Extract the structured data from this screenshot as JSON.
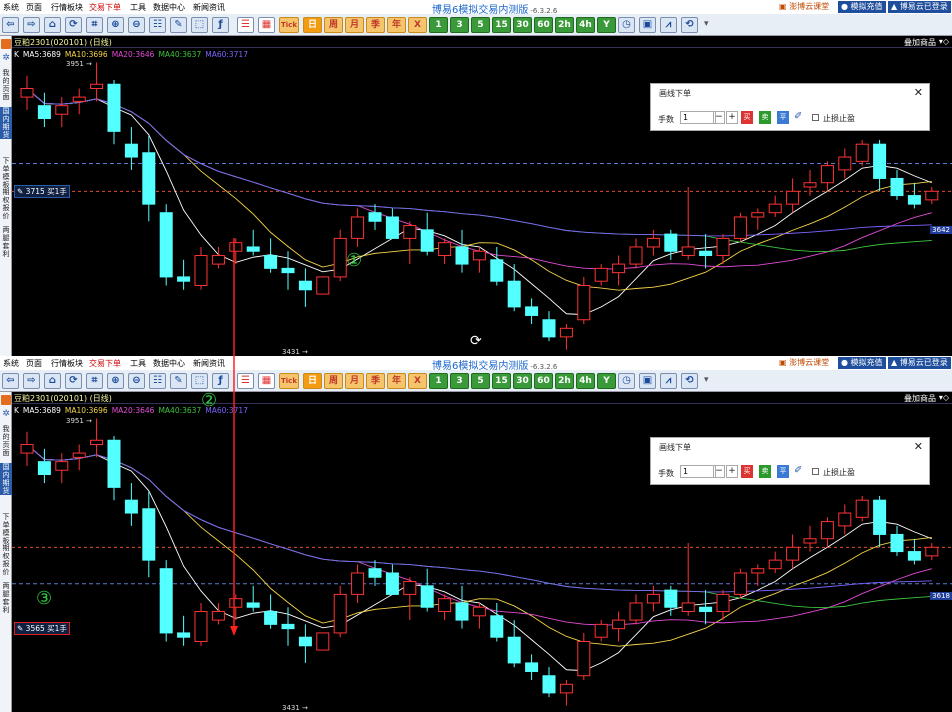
{
  "menu": [
    "系统",
    "页面",
    "行情板块",
    "交易下单",
    "工具",
    "数据中心",
    "新闻资讯"
  ],
  "menu_red_index": 3,
  "app_title": "博易6模拟交易内测版",
  "app_version": "-6.3.2.6",
  "right_buttons": [
    "澎博云课堂",
    "模拟充值",
    "博易云已登录"
  ],
  "toolbar": {
    "period_buttons": [
      "日",
      "周",
      "月",
      "季",
      "年"
    ],
    "x_button": "X",
    "num_buttons": [
      "1",
      "3",
      "5",
      "15",
      "30",
      "60",
      "2h",
      "4h",
      "Y"
    ],
    "tick_label": "Tick",
    "more": "▾"
  },
  "sidebar_tabs": [
    "我的页面",
    "国内期货",
    "下单模板",
    "期权报价",
    "两腿套利"
  ],
  "symbol_header": "豆粕2301(020101) (日线)",
  "add_product": "叠加商品",
  "ma_legend": [
    {
      "label": "K",
      "color": "#ffffff"
    },
    {
      "label": "MA5:3689",
      "color": "#ffffff"
    },
    {
      "label": "MA10:3696",
      "color": "#f5d547"
    },
    {
      "label": "MA20:3646",
      "color": "#e44bd6"
    },
    {
      "label": "MA40:3637",
      "color": "#3ec43e"
    },
    {
      "label": "MA60:3717",
      "color": "#7b62ff"
    }
  ],
  "high_label": "3951",
  "low_label": "3431",
  "dialog": {
    "title": "画线下单",
    "qty_label": "手数",
    "qty_value": "1",
    "minus": "−",
    "plus": "+",
    "buy": "买",
    "sell": "卖",
    "flat": "平",
    "stop_label": "止损止盈",
    "close": "✕"
  },
  "top_pane": {
    "buy_line_label": "3715 买1手",
    "right_price": "3642",
    "marker": "①"
  },
  "bottom_pane": {
    "buy_line_label": "3565 买1手",
    "right_price": "3618",
    "marker2": "②",
    "marker3": "③"
  },
  "colors": {
    "up": "#ff3333",
    "down": "#54ffff",
    "ma5": "#ffffff",
    "ma10": "#f5d547",
    "ma20": "#e44bd6",
    "ma40": "#3ec43e",
    "ma60": "#7b62ff"
  },
  "chart_data": {
    "type": "candlestick",
    "ohlc": [
      [
        3870,
        3920,
        3840,
        3890
      ],
      [
        3850,
        3880,
        3800,
        3820
      ],
      [
        3830,
        3870,
        3800,
        3850
      ],
      [
        3860,
        3890,
        3830,
        3870
      ],
      [
        3890,
        3951,
        3860,
        3900
      ],
      [
        3900,
        3910,
        3760,
        3790
      ],
      [
        3760,
        3800,
        3700,
        3730
      ],
      [
        3740,
        3780,
        3580,
        3620
      ],
      [
        3600,
        3620,
        3430,
        3450
      ],
      [
        3450,
        3490,
        3420,
        3440
      ],
      [
        3430,
        3520,
        3420,
        3500
      ],
      [
        3480,
        3520,
        3470,
        3500
      ],
      [
        3510,
        3540,
        3480,
        3530
      ],
      [
        3520,
        3560,
        3500,
        3510
      ],
      [
        3500,
        3540,
        3460,
        3470
      ],
      [
        3470,
        3510,
        3420,
        3460
      ],
      [
        3440,
        3470,
        3380,
        3420
      ],
      [
        3410,
        3440,
        3431,
        3450
      ],
      [
        3450,
        3560,
        3440,
        3540
      ],
      [
        3540,
        3610,
        3520,
        3590
      ],
      [
        3600,
        3620,
        3560,
        3580
      ],
      [
        3590,
        3610,
        3540,
        3540
      ],
      [
        3540,
        3580,
        3480,
        3570
      ],
      [
        3560,
        3600,
        3500,
        3510
      ],
      [
        3500,
        3540,
        3480,
        3530
      ],
      [
        3520,
        3560,
        3460,
        3480
      ],
      [
        3490,
        3520,
        3460,
        3510
      ],
      [
        3490,
        3520,
        3430,
        3440
      ],
      [
        3440,
        3480,
        3370,
        3380
      ],
      [
        3380,
        3400,
        3340,
        3360
      ],
      [
        3350,
        3370,
        3300,
        3310
      ],
      [
        3310,
        3340,
        3280,
        3330
      ],
      [
        3350,
        3450,
        3340,
        3430
      ],
      [
        3440,
        3480,
        3430,
        3470
      ],
      [
        3460,
        3500,
        3430,
        3480
      ],
      [
        3480,
        3540,
        3470,
        3520
      ],
      [
        3520,
        3560,
        3500,
        3540
      ],
      [
        3550,
        3560,
        3490,
        3510
      ],
      [
        3500,
        3660,
        3490,
        3520
      ],
      [
        3510,
        3550,
        3470,
        3500
      ],
      [
        3500,
        3550,
        3480,
        3540
      ],
      [
        3540,
        3600,
        3530,
        3590
      ],
      [
        3590,
        3610,
        3560,
        3600
      ],
      [
        3600,
        3640,
        3590,
        3620
      ],
      [
        3620,
        3680,
        3600,
        3650
      ],
      [
        3660,
        3700,
        3640,
        3670
      ],
      [
        3670,
        3720,
        3650,
        3710
      ],
      [
        3700,
        3750,
        3680,
        3730
      ],
      [
        3720,
        3770,
        3710,
        3760
      ],
      [
        3760,
        3770,
        3650,
        3680
      ],
      [
        3680,
        3700,
        3630,
        3640
      ],
      [
        3640,
        3670,
        3610,
        3620
      ],
      [
        3630,
        3660,
        3620,
        3650
      ]
    ],
    "y_range": [
      3270,
      3980
    ],
    "high": 3951,
    "low": 3431
  }
}
